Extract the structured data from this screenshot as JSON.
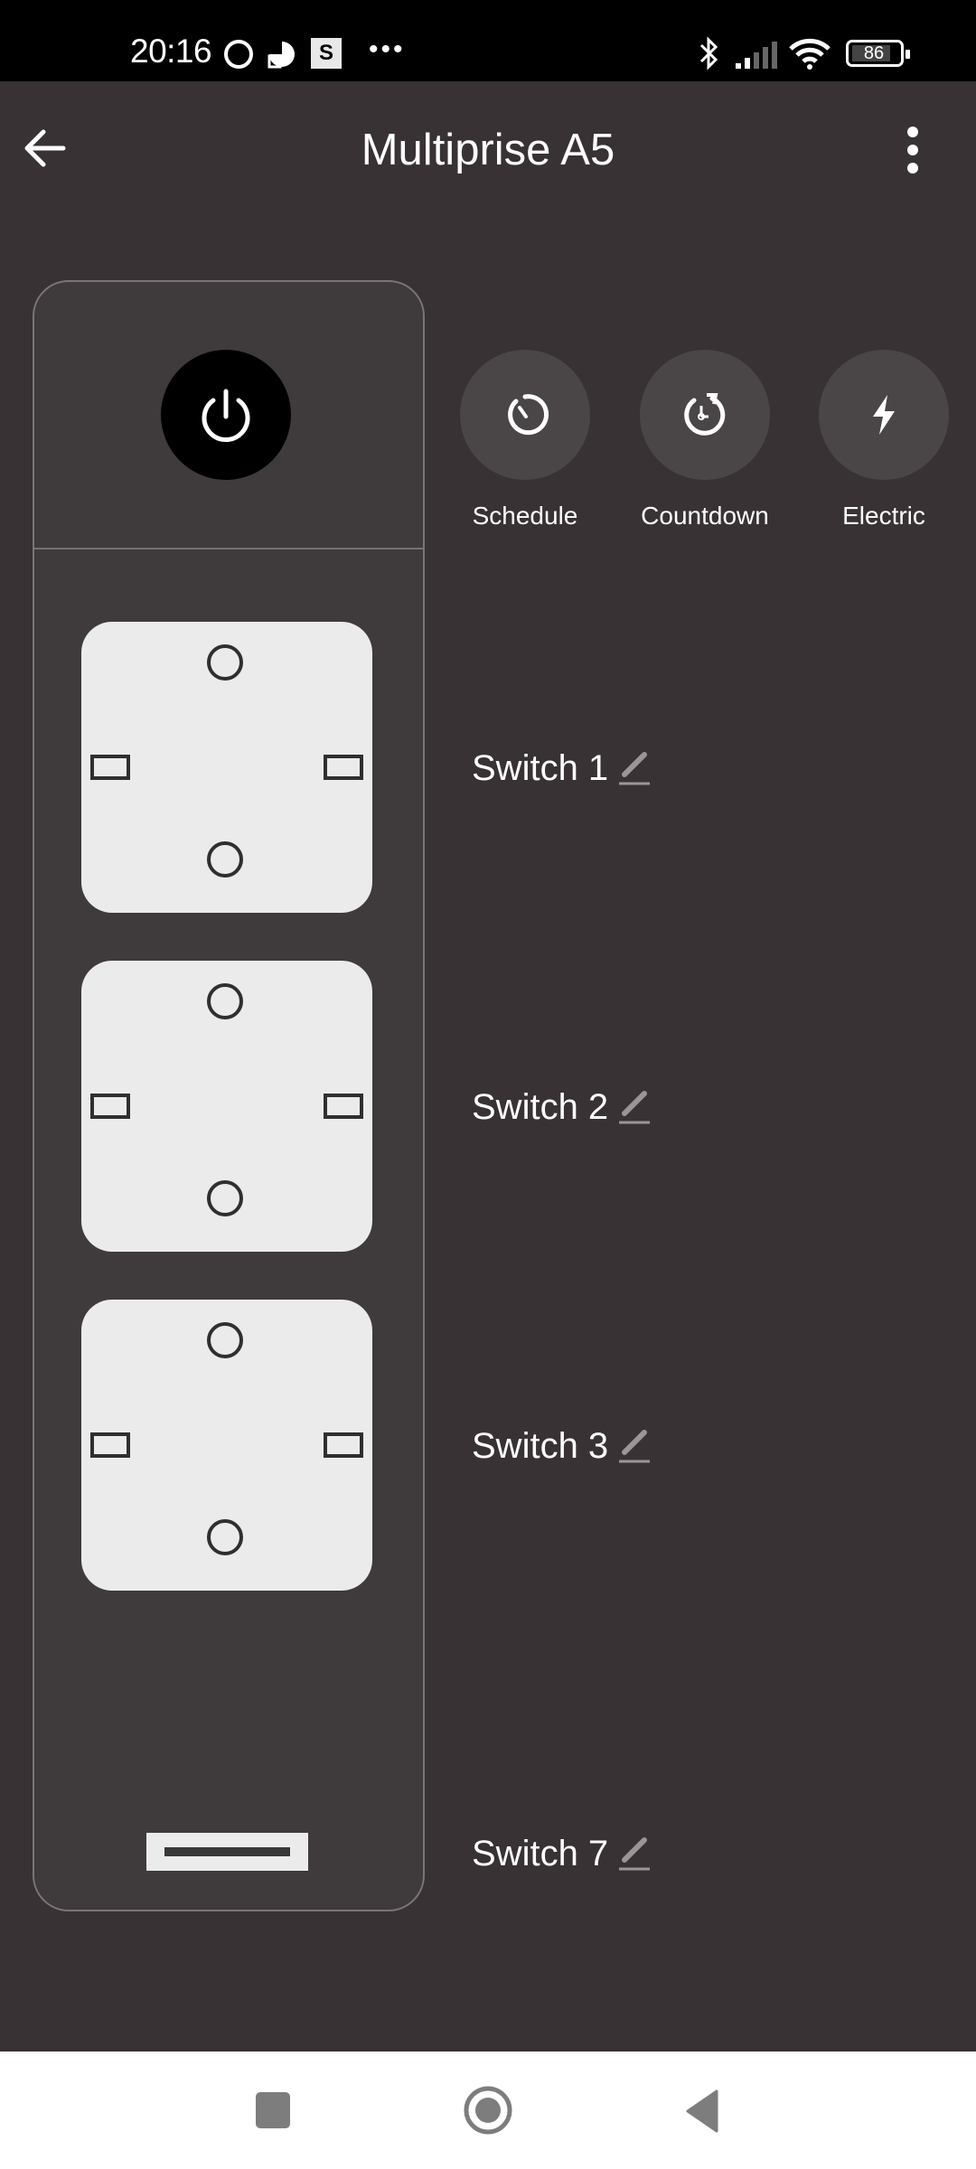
{
  "status_bar": {
    "time": "20:16",
    "notification_icons": [
      "ring-icon",
      "pie-icon",
      "s-app-icon"
    ],
    "s_app_letter": "S",
    "more_notifications": "•••",
    "battery_level": "86",
    "system_icons": [
      "bluetooth-icon",
      "signal-icon",
      "wifi-icon",
      "battery-icon"
    ]
  },
  "header": {
    "title": "Multiprise A5",
    "back_icon": "arrow-left-icon",
    "menu_icon": "more-vertical-icon"
  },
  "device": {
    "power_icon": "power-icon",
    "power_button_color": "#000000",
    "socket_count": 3,
    "socket_color": "#ebebeb"
  },
  "actions": [
    {
      "label": "Schedule",
      "icon": "timer-icon"
    },
    {
      "label": "Countdown",
      "icon": "countdown-icon"
    },
    {
      "label": "Electric",
      "icon": "lightning-icon"
    }
  ],
  "switches": [
    {
      "name": "Switch 1",
      "icon": "edit-pencil-icon"
    },
    {
      "name": "Switch 2",
      "icon": "edit-pencil-icon"
    },
    {
      "name": "Switch 3",
      "icon": "edit-pencil-icon"
    },
    {
      "name": "Switch 7",
      "icon": "edit-pencil-icon"
    }
  ],
  "nav_bar": {
    "buttons": [
      "recents",
      "home",
      "back"
    ]
  },
  "colors": {
    "background": "#383234",
    "card": "#3f3a3c",
    "action_circle": "#4a4647",
    "text": "#ffffff"
  }
}
